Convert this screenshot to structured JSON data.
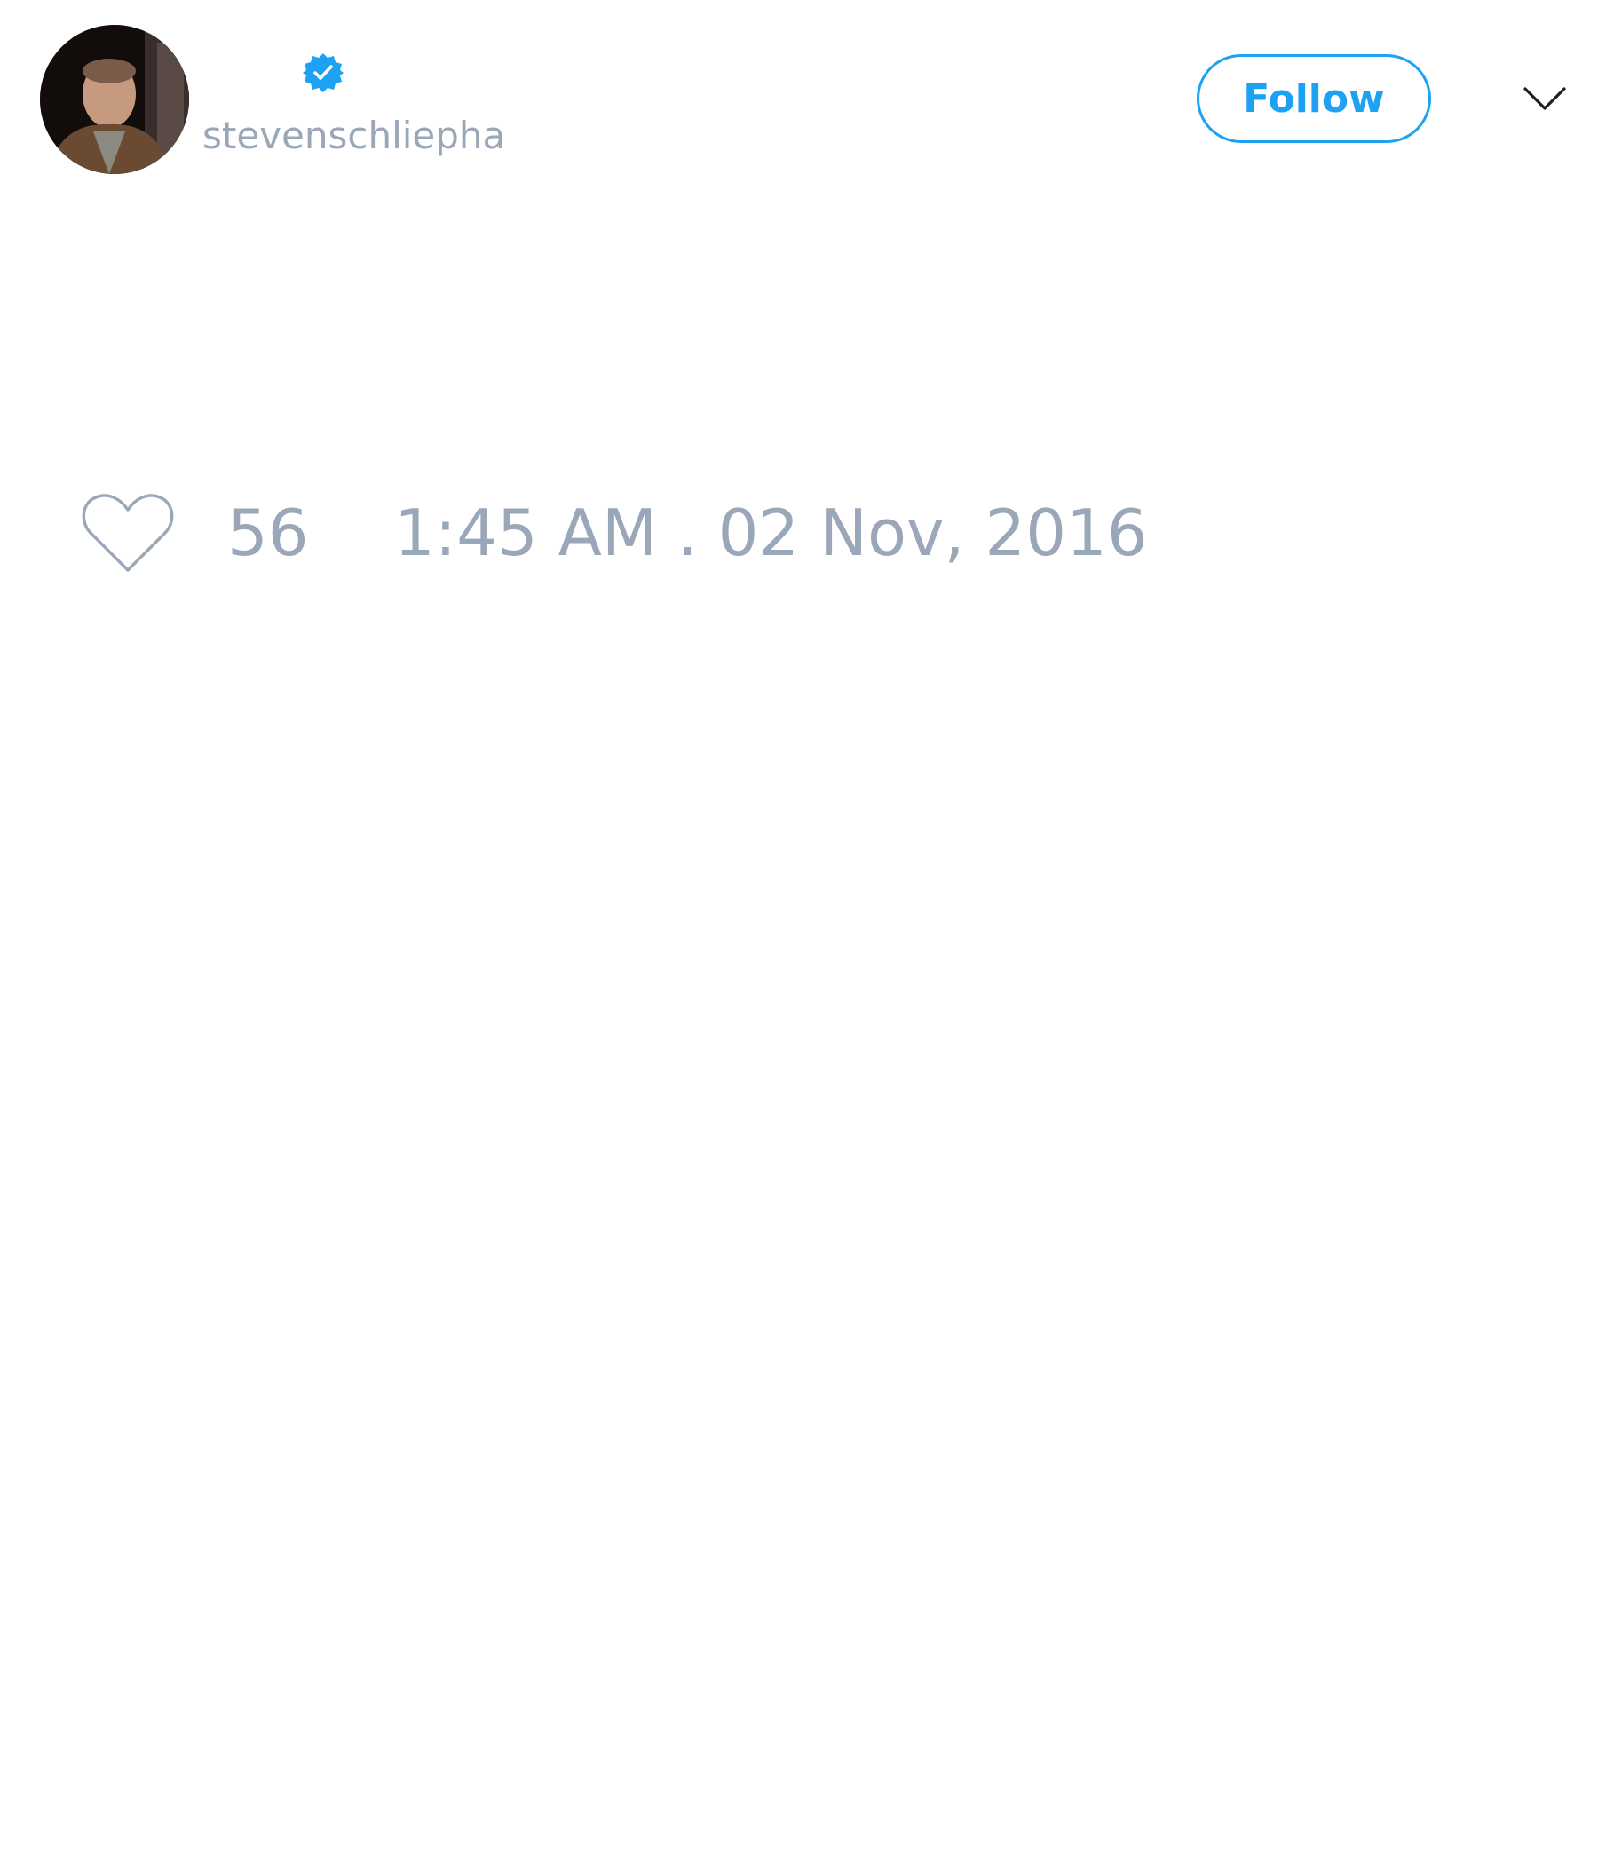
{
  "author": {
    "username": "stevenschliepha",
    "verified": true,
    "avatar_alt": "profile photo"
  },
  "actions": {
    "follow_label": "Follow",
    "more_icon": "chevron-down-icon"
  },
  "footer": {
    "like_icon": "heart-icon",
    "like_count": "56",
    "timestamp": "1:45 AM . 02 Nov, 2016"
  },
  "colors": {
    "accent": "#1da1f2",
    "muted_text": "#9aa7b8",
    "background": "#ffffff"
  }
}
